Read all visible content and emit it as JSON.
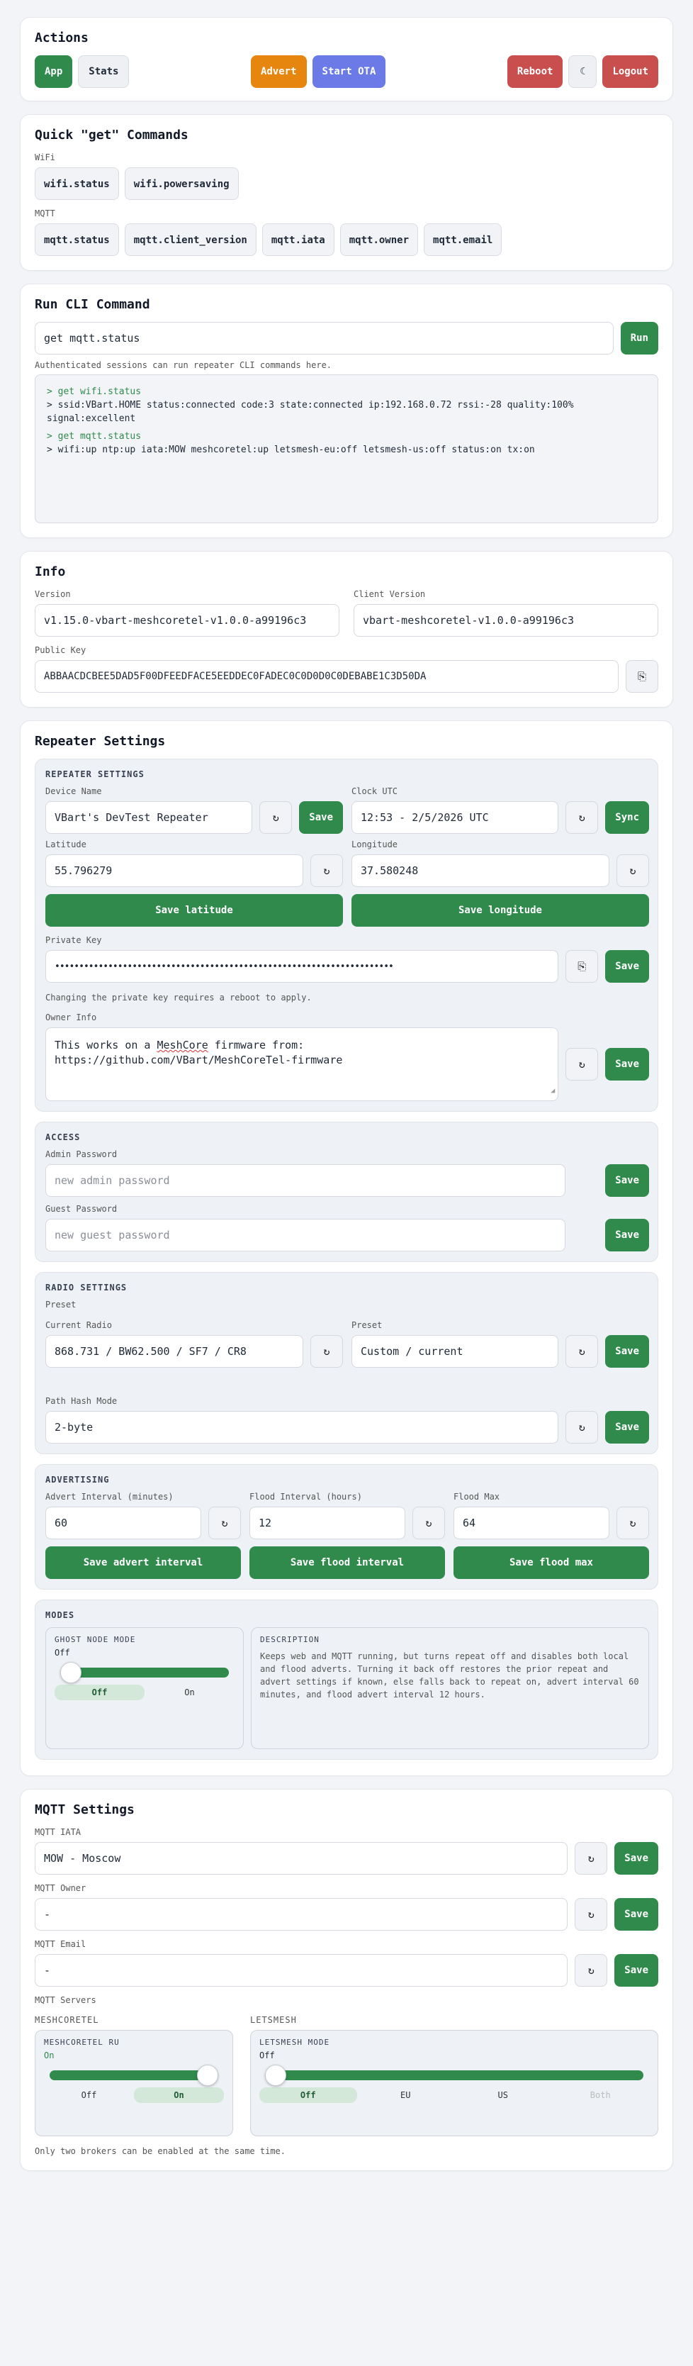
{
  "actions": {
    "title": "Actions",
    "app": "App",
    "stats": "Stats",
    "advert": "Advert",
    "start_ota": "Start OTA",
    "reboot": "Reboot",
    "theme_icon": "☾",
    "logout": "Logout"
  },
  "quick": {
    "title": "Quick \"get\" Commands",
    "wifi_label": "WiFi",
    "wifi": [
      "wifi.status",
      "wifi.powersaving"
    ],
    "mqtt_label": "MQTT",
    "mqtt": [
      "mqtt.status",
      "mqtt.client_version",
      "mqtt.iata",
      "mqtt.owner",
      "mqtt.email"
    ]
  },
  "cli": {
    "title": "Run CLI Command",
    "input": "get mqtt.status",
    "run": "Run",
    "note": "Authenticated sessions can run repeater CLI commands here.",
    "log": [
      {
        "cmd": "> get wifi.status",
        "out": "> ssid:VBart.HOME status:connected code:3 state:connected ip:192.168.0.72 rssi:-28 quality:100% signal:excellent"
      },
      {
        "cmd": "> get mqtt.status",
        "out": "> wifi:up ntp:up iata:MOW meshcoretel:up letsmesh-eu:off letsmesh-us:off status:on tx:on"
      }
    ]
  },
  "info": {
    "title": "Info",
    "version_label": "Version",
    "version": "v1.15.0-vbart-meshcoretel-v1.0.0-a99196c3",
    "client_label": "Client Version",
    "client": "vbart-meshcoretel-v1.0.0-a99196c3",
    "pubkey_label": "Public Key",
    "pubkey": "ABBAACDCBEE5DAD5F00DFEEDFACE5EEDDEC0FADEC0C0D0D0C0DEBABE1C3D50DA",
    "copy_icon": "⎘"
  },
  "repeater": {
    "title": "Repeater Settings",
    "section": "REPEATER SETTINGS",
    "device_label": "Device Name",
    "device": "VBart's DevTest Repeater",
    "clock_label": "Clock UTC",
    "clock": "12:53 - 2/5/2026 UTC",
    "sync": "Sync",
    "lat_label": "Latitude",
    "lat": "55.796279",
    "lon_label": "Longitude",
    "lon": "37.580248",
    "save_lat": "Save latitude",
    "save_lon": "Save longitude",
    "pk_label": "Private Key",
    "pk": "••••••••••••••••••••••••••••••••••••••••••••••••••••••••••••••••••••••",
    "pk_note": "Changing the private key requires a reboot to apply.",
    "owner_label": "Owner Info",
    "owner_pre": "This works on a ",
    "owner_mc": "MeshCore",
    "owner_post": " firmware from:\nhttps://github.com/VBart/MeshCoreTel-firmware",
    "save": "Save",
    "refresh": "↻"
  },
  "access": {
    "section": "ACCESS",
    "admin_label": "Admin Password",
    "admin_ph": "new admin password",
    "guest_label": "Guest Password",
    "guest_ph": "new guest password"
  },
  "radio": {
    "section": "RADIO SETTINGS",
    "preset_head": "Preset",
    "current_label": "Current Radio",
    "current": "868.731 / BW62.500 / SF7 / CR8",
    "preset_label": "Preset",
    "preset": "Custom / current",
    "path_label": "Path Hash Mode",
    "path": "2-byte"
  },
  "advert": {
    "section": "ADVERTISING",
    "ai_label": "Advert Interval (minutes)",
    "ai": "60",
    "fi_label": "Flood Interval (hours)",
    "fi": "12",
    "fm_label": "Flood Max",
    "fm": "64",
    "save_ai": "Save advert interval",
    "save_fi": "Save flood interval",
    "save_fm": "Save flood max"
  },
  "modes": {
    "section": "MODES",
    "ghost_title": "GHOST NODE MODE",
    "ghost_state": "Off",
    "ghost_level": 0,
    "opt_off": "Off",
    "opt_on": "On",
    "desc_title": "DESCRIPTION",
    "desc": "Keeps web and MQTT running, but turns repeat off and disables both local and flood adverts. Turning it back off restores the prior repeat and advert settings if known, else falls back to repeat on, advert interval 60 minutes, and flood advert interval 12 hours."
  },
  "mqtt": {
    "title": "MQTT Settings",
    "iata_label": "MQTT IATA",
    "iata": "MOW - Moscow",
    "owner_label": "MQTT Owner",
    "owner": "-",
    "email_label": "MQTT Email",
    "email": "-",
    "servers_label": "MQTT Servers",
    "col1": "MESHCORETEL",
    "col2": "LETSMESH",
    "mc_title": "MESHCORETEL RU",
    "mc_state": "On",
    "mc_level": 1,
    "lm_title": "LETSMESH MODE",
    "lm_state": "Off",
    "lm_level": 0,
    "lm_opts": [
      "Off",
      "EU",
      "US",
      "Both"
    ],
    "note": "Only two brokers can be enabled at the same time."
  },
  "colors": {
    "green": "#2f8a4c",
    "orange": "#e7860e",
    "blue": "#6b7ae6",
    "red": "#c94f4f"
  }
}
